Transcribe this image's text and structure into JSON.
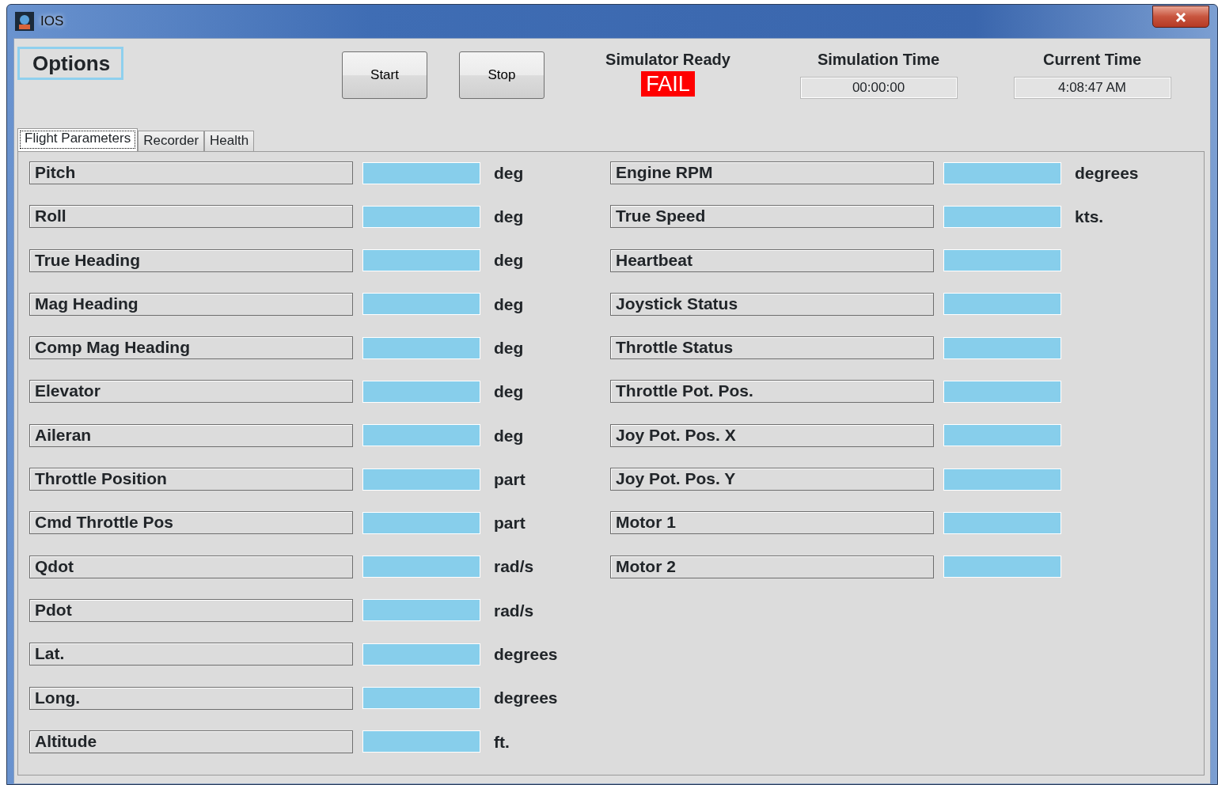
{
  "window": {
    "title": "IOS"
  },
  "options_label": "Options",
  "buttons": [
    "Start",
    "Stop"
  ],
  "simulator_ready": {
    "label": "Simulator Ready",
    "value": "FAIL",
    "ready": false
  },
  "simulation_time": {
    "label": "Simulation Time",
    "value": "00:00:00"
  },
  "current_time": {
    "label": "Current Time",
    "value": "4:08:47 AM"
  },
  "tabs": [
    {
      "label": "Flight Parameters",
      "selected": true
    },
    {
      "label": "Recorder",
      "selected": false
    },
    {
      "label": "Health",
      "selected": false
    }
  ],
  "left_parameters": [
    {
      "name": "Pitch",
      "unit": "deg"
    },
    {
      "name": "Roll",
      "unit": "deg"
    },
    {
      "name": "True Heading",
      "unit": "deg"
    },
    {
      "name": "Mag Heading",
      "unit": "deg"
    },
    {
      "name": "Comp Mag Heading",
      "unit": "deg"
    },
    {
      "name": "Elevator",
      "unit": "deg"
    },
    {
      "name": "Aileran",
      "unit": "deg"
    },
    {
      "name": "Throttle Position",
      "unit": "part"
    },
    {
      "name": "Cmd Throttle Pos",
      "unit": "part"
    },
    {
      "name": "Qdot",
      "unit": "rad/s"
    },
    {
      "name": "Pdot",
      "unit": "rad/s"
    },
    {
      "name": "Lat.",
      "unit": "degrees"
    },
    {
      "name": "Long.",
      "unit": "degrees"
    },
    {
      "name": "Altitude",
      "unit": "ft."
    }
  ],
  "right_parameters": [
    {
      "name": "Engine RPM",
      "unit": "degrees"
    },
    {
      "name": "True Speed",
      "unit": "kts."
    },
    {
      "name": "Heartbeat"
    },
    {
      "name": "Joystick Status"
    },
    {
      "name": "Throttle Status"
    },
    {
      "name": "Throttle Pot. Pos."
    },
    {
      "name": "Joy Pot. Pos. X"
    },
    {
      "name": "Joy Pot. Pos. Y"
    },
    {
      "name": "Motor 1"
    },
    {
      "name": "Motor 2"
    }
  ]
}
